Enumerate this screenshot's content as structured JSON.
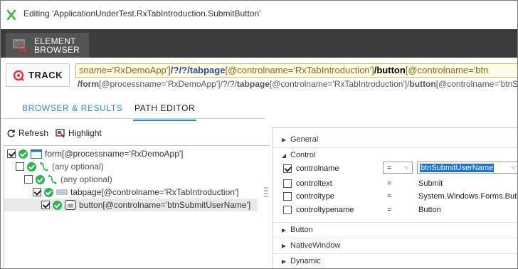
{
  "window": {
    "title": "Editing 'ApplicationUnderTest.RxTabIntroduction.SubmitButton'"
  },
  "ribbon": {
    "element_browser_line1": "ELEMENT",
    "element_browser_line2": "BROWSER"
  },
  "track": {
    "label": "TRACK",
    "path": {
      "seg_a": "sname='RxDemoApp']",
      "seg_b": "/?/?/",
      "seg_c": "tabpage",
      "seg_c2": "[@controlname='RxTabIntroduction']",
      "seg_d": "/button",
      "seg_e": "[@controlname='btn"
    },
    "path_sub": {
      "part1": "/form",
      "part2": "[@processname='RxDemoApp']/?/?/",
      "part3": "tabpage",
      "part4": "[@controlname='RxTabIntroduction']/",
      "part5": "button",
      "part6": "[@controlname='btnSubmitU"
    }
  },
  "tabs": {
    "browser": "BROWSER & RESULTS",
    "path_editor": "PATH EDITOR"
  },
  "toolbar": {
    "refresh": "Refresh",
    "highlight": "Highlight"
  },
  "tree": {
    "rows": [
      {
        "text": "form[@processname='RxDemoApp']"
      },
      {
        "text": "(any optional)"
      },
      {
        "text": "(any optional)"
      },
      {
        "text": "tabpage[@controlname='RxTabIntroduction']"
      },
      {
        "text": "button[@controlname='btnSubmitUserName']"
      }
    ]
  },
  "properties": {
    "sections": {
      "general": "General",
      "control": "Control",
      "button": "Button",
      "native_window": "NativeWindow",
      "dynamic": "Dynamic"
    },
    "rows": [
      {
        "name": "controlname",
        "op": "=",
        "value": "btnSubmitUserName",
        "checked": true
      },
      {
        "name": "controltext",
        "op": "=",
        "value": "Submit",
        "checked": false
      },
      {
        "name": "controltype",
        "op": "=",
        "value": "System.Windows.Forms.Butt",
        "checked": false
      },
      {
        "name": "controltypename",
        "op": "=",
        "value": "Button",
        "checked": false
      }
    ]
  },
  "colors": {
    "ribbon": "#3c3c3c",
    "accent": "#2a8fd1",
    "ok_green": "#2eb352",
    "track_red": "#e0343c"
  }
}
